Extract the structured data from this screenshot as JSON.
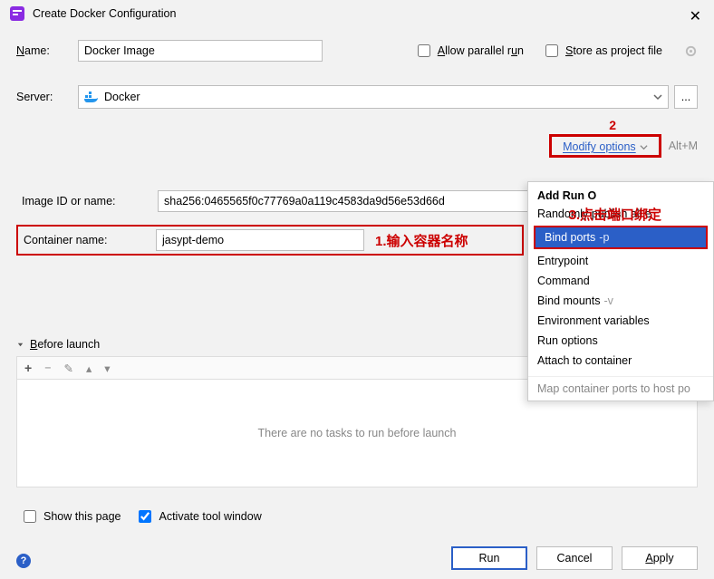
{
  "window": {
    "title": "Create Docker Configuration"
  },
  "form": {
    "name_label": "Name:",
    "name_value": "Docker Image",
    "allow_parallel_label": "Allow parallel run",
    "store_project_label": "Store as project file",
    "server_label": "Server:",
    "server_value": "Docker",
    "ellipsis": "...",
    "image_label": "Image ID or name:",
    "image_value": "sha256:0465565f0c77769a0a119c4583da9d56e53d66d",
    "container_label": "Container name:",
    "container_value": "jasypt-demo"
  },
  "modify": {
    "link_label": "Modify options",
    "shortcut": "Alt+M"
  },
  "popup": {
    "header": "Add Run O",
    "items": [
      {
        "label": "Randomly publish all e",
        "suffix": "",
        "selected": false
      },
      {
        "label": "Bind ports",
        "suffix": "-p",
        "selected": true
      },
      {
        "label": "Entrypoint",
        "suffix": "",
        "selected": false
      },
      {
        "label": "Command",
        "suffix": "",
        "selected": false
      },
      {
        "label": "Bind mounts",
        "suffix": "-v",
        "selected": false
      },
      {
        "label": "Environment variables",
        "suffix": "",
        "selected": false
      },
      {
        "label": "Run options",
        "suffix": "",
        "selected": false
      },
      {
        "label": "Attach to container",
        "suffix": "",
        "selected": false
      }
    ],
    "footer": "Map container ports to host po"
  },
  "before": {
    "header": "Before launch",
    "placeholder": "There are no tasks to run before launch"
  },
  "bottom": {
    "show_page": "Show this page",
    "activate_tw": "Activate tool window"
  },
  "buttons": {
    "run": "Run",
    "cancel": "Cancel",
    "apply": "Apply"
  },
  "annotations": {
    "a1": "1.输入容器名称",
    "a2": "2",
    "a3": "3.点击端口绑定"
  }
}
